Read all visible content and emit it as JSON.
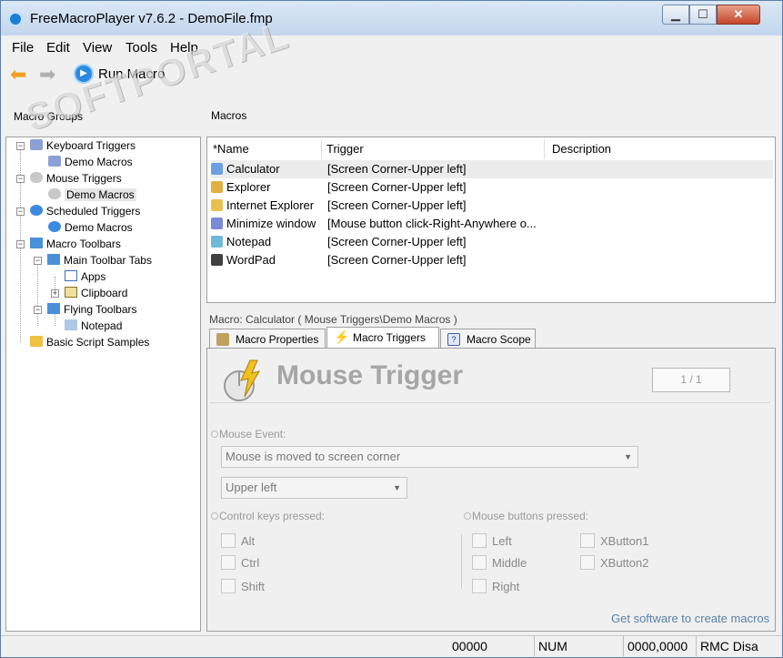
{
  "window": {
    "title": "FreeMacroPlayer v7.6.2 - DemoFile.fmp",
    "min": "▁",
    "max": "☐",
    "close": "✕"
  },
  "menu": [
    "File",
    "Edit",
    "View",
    "Tools",
    "Help"
  ],
  "toolbar": {
    "back_icon": "arrow-left-icon",
    "forward_icon": "arrow-right-icon",
    "run_label": "Run Macro"
  },
  "watermark": "SOFTPORTAL",
  "groups": {
    "header": "Macro Groups",
    "items": [
      "Keyboard Triggers",
      "Demo Macros",
      "Mouse Triggers",
      "Demo Macros",
      "Scheduled Triggers",
      "Demo Macros",
      "Macro Toolbars",
      "Main Toolbar Tabs",
      "Apps",
      "Clipboard",
      "Flying Toolbars",
      "Notepad",
      "Basic Script Samples"
    ],
    "selected": "Demo Macros"
  },
  "macros": {
    "header": "Macros",
    "columns": [
      "*Name",
      "Trigger",
      "Description"
    ],
    "rows": [
      {
        "name": "Calculator",
        "trigger": "[Screen Corner-Upper left]",
        "icon_color": "#6aa0e0"
      },
      {
        "name": "Explorer",
        "trigger": "[Screen Corner-Upper left]",
        "icon_color": "#e0b040"
      },
      {
        "name": "Internet Explorer",
        "trigger": "[Screen Corner-Upper left]",
        "icon_color": "#e8c050"
      },
      {
        "name": "Minimize window",
        "trigger": "[Mouse button click-Right-Anywhere o...",
        "icon_color": "#7a8ad8"
      },
      {
        "name": "Notepad",
        "trigger": "[Screen Corner-Upper left]",
        "icon_color": "#70b8d8"
      },
      {
        "name": "WordPad",
        "trigger": "[Screen Corner-Upper left]",
        "icon_color": "#404040"
      }
    ]
  },
  "detail": {
    "title": "Macro: Calculator ( Mouse Triggers\\Demo Macros )",
    "tabs": [
      "Macro Properties",
      "Macro Triggers",
      "Macro Scope"
    ],
    "active_tab": "Macro Triggers",
    "heading": "Mouse Trigger",
    "pager": "1 / 1",
    "mouse_event_label": "Mouse Event:",
    "mouse_event_value": "Mouse is moved to screen corner",
    "corner_value": "Upper left",
    "control_keys_label": "Control keys pressed:",
    "control_keys": [
      "Alt",
      "Ctrl",
      "Shift"
    ],
    "mouse_buttons_label": "Mouse buttons pressed:",
    "mouse_buttons_left": [
      "Left",
      "Middle",
      "Right"
    ],
    "mouse_buttons_right": [
      "XButton1",
      "XButton2"
    ],
    "link": "Get software to create macros"
  },
  "status": {
    "pos": "00000",
    "num": "NUM",
    "coords": "0000,0000",
    "rmc": "RMC Disa"
  }
}
